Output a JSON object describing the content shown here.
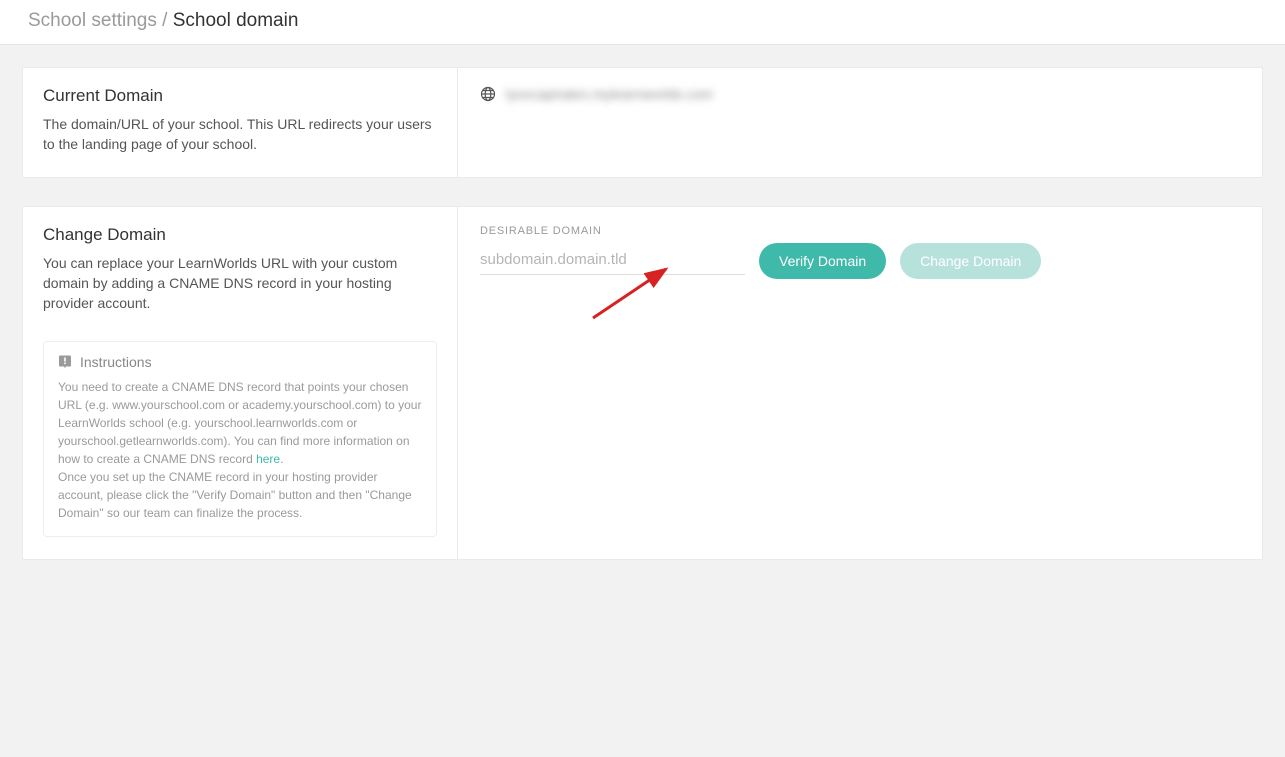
{
  "breadcrumb": {
    "parent": "School settings",
    "sep": "/",
    "current": "School domain"
  },
  "currentDomain": {
    "title": "Current Domain",
    "desc": "The domain/URL of your school. This URL redirects your users to the landing page of your school.",
    "value": "lyoxcapiraten.mylearnworlds.com"
  },
  "changeDomain": {
    "title": "Change Domain",
    "desc": "You can replace your LearnWorlds URL with your custom domain by adding a CNAME DNS record in your hosting provider account.",
    "fieldLabel": "DESIRABLE DOMAIN",
    "placeholder": "subdomain.domain.tld",
    "verifyLabel": "Verify Domain",
    "changeLabel": "Change Domain"
  },
  "instructions": {
    "title": "Instructions",
    "body1": "You need to create a CNAME DNS record that points your chosen URL (e.g. www.yourschool.com or academy.yourschool.com) to your LearnWorlds school (e.g. yourschool.learnworlds.com or yourschool.getlearnworlds.com). You can find more information on how to create a CNAME DNS record ",
    "linkText": "here",
    "body2": ".",
    "body3": "Once you set up the CNAME record in your hosting provider account, please click the \"Verify Domain\" button and then \"Change Domain\" so our team can finalize the process."
  }
}
